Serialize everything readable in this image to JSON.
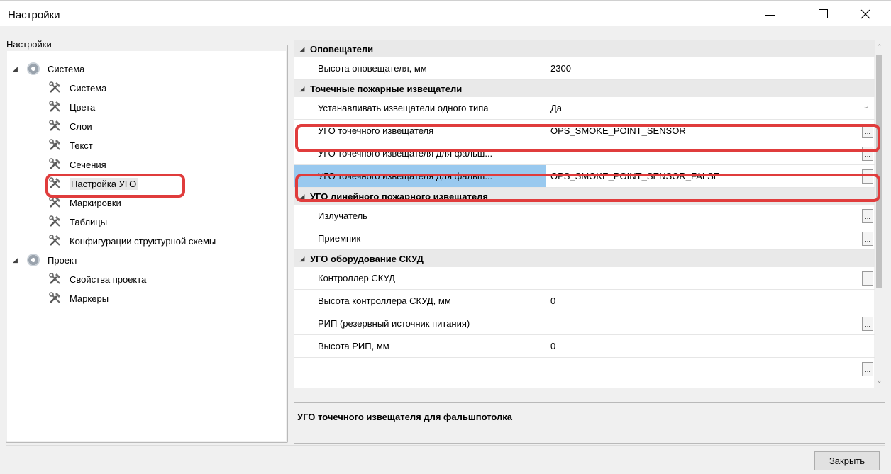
{
  "window": {
    "title": "Настройки"
  },
  "left_panel": {
    "group_label": "Настройки",
    "tree": [
      {
        "label": "Система",
        "type": "root",
        "icon": "gear-icon"
      },
      {
        "label": "Система",
        "type": "child",
        "icon": "tools-icon"
      },
      {
        "label": "Цвета",
        "type": "child",
        "icon": "tools-icon"
      },
      {
        "label": "Слои",
        "type": "child",
        "icon": "tools-icon"
      },
      {
        "label": "Текст",
        "type": "child",
        "icon": "tools-icon"
      },
      {
        "label": "Сечения",
        "type": "child",
        "icon": "tools-icon"
      },
      {
        "label": "Настройка УГО",
        "type": "child",
        "icon": "tools-icon",
        "selected": true
      },
      {
        "label": "Маркировки",
        "type": "child",
        "icon": "tools-icon"
      },
      {
        "label": "Таблицы",
        "type": "child",
        "icon": "tools-icon"
      },
      {
        "label": "Конфигурации структурной схемы",
        "type": "child",
        "icon": "tools-icon"
      },
      {
        "label": "Проект",
        "type": "root",
        "icon": "gear-icon"
      },
      {
        "label": "Свойства проекта",
        "type": "child",
        "icon": "tools-icon"
      },
      {
        "label": "Маркеры",
        "type": "child",
        "icon": "tools-icon"
      }
    ]
  },
  "property_grid": {
    "rows": [
      {
        "kind": "category",
        "label": "Оповещатели"
      },
      {
        "kind": "prop",
        "name": "Высота оповещателя, мм",
        "value": "2300",
        "editor": "none"
      },
      {
        "kind": "category",
        "label": "Точечные пожарные извещатели"
      },
      {
        "kind": "prop",
        "name": "Устанавливать извещатели одного типа",
        "value": "Да",
        "editor": "dropdown"
      },
      {
        "kind": "prop",
        "name": "УГО точечного извещателя",
        "value": "OPS_SMOKE_POINT_SENSOR",
        "editor": "ellipsis"
      },
      {
        "kind": "prop",
        "name": "УГО точечного извещателя для фальш...",
        "value": "",
        "editor": "ellipsis"
      },
      {
        "kind": "prop",
        "name": "УГО точечного извещателя для фальш...",
        "value": "OPS_SMOKE_POINT_SENSOR_FALSE",
        "editor": "ellipsis",
        "selected": true
      },
      {
        "kind": "category",
        "label": "УГО линейного пожарного извещателя"
      },
      {
        "kind": "prop",
        "name": "Излучатель",
        "value": "",
        "editor": "ellipsis"
      },
      {
        "kind": "prop",
        "name": "Приемник",
        "value": "",
        "editor": "ellipsis"
      },
      {
        "kind": "category",
        "label": "УГО оборудование СКУД"
      },
      {
        "kind": "prop",
        "name": "Контроллер СКУД",
        "value": "",
        "editor": "ellipsis"
      },
      {
        "kind": "prop",
        "name": "Высота контроллера СКУД, мм",
        "value": "0",
        "editor": "none"
      },
      {
        "kind": "prop",
        "name": "РИП (резервный источник питания)",
        "value": "",
        "editor": "ellipsis"
      },
      {
        "kind": "prop",
        "name": "Высота РИП, мм",
        "value": "0",
        "editor": "none"
      },
      {
        "kind": "prop",
        "name": "",
        "value": "",
        "editor": "ellipsis"
      }
    ]
  },
  "description": {
    "text": "УГО точечного извещателя для фальшпотолка"
  },
  "buttons": {
    "close": "Закрыть",
    "ellipsis": "..."
  },
  "colors": {
    "highlight": "#e03c3c",
    "selection": "#99c9ef"
  }
}
